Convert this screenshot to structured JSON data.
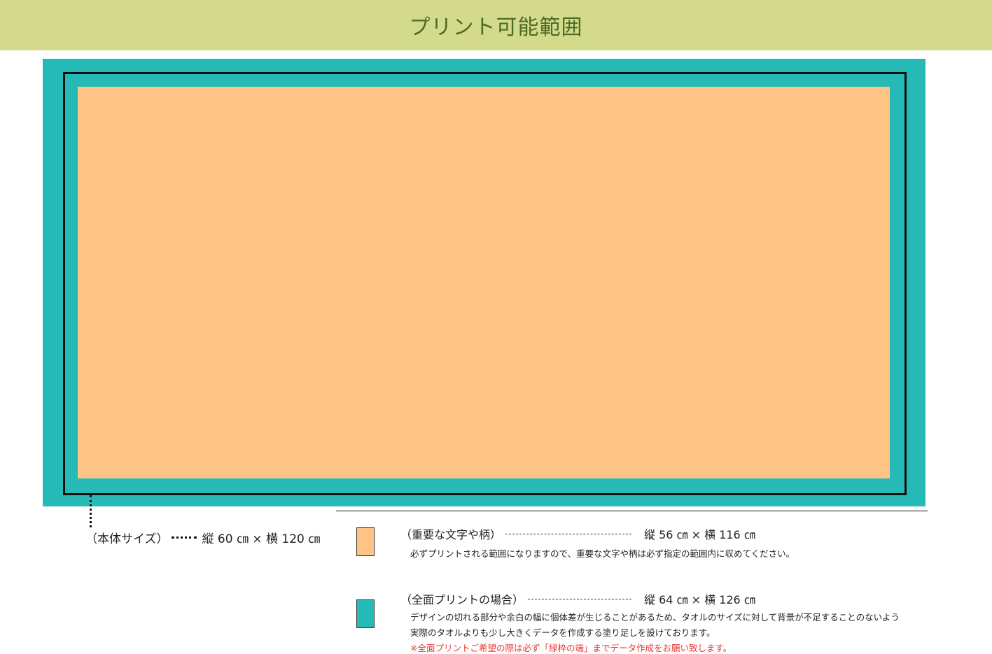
{
  "header": {
    "title": "プリント可能範囲"
  },
  "colors": {
    "header_bg": "#d3da8b",
    "header_text": "#4e6b25",
    "bleed": "#26bab6",
    "safe": "#ffc385",
    "outline": "#111111",
    "note_red": "#e53935"
  },
  "body_size": {
    "label": "（本体サイズ）",
    "dims": "縦 60 ㎝ × 横 120 ㎝"
  },
  "legend": {
    "safe": {
      "label": "（重要な文字や柄）",
      "dims": "縦 56 ㎝ × 横 116 ㎝",
      "desc": "必ずプリントされる範囲になりますので、重要な文字や柄は必ず指定の範囲内に収めてください。"
    },
    "bleed": {
      "label": "（全面プリントの場合）",
      "dims": "縦 64 ㎝ × 横 126 ㎝",
      "desc1": "デザインの切れる部分や余白の幅に個体差が生じることがあるため、タオルのサイズに対して背景が不足することのないよう",
      "desc2": "実際のタオルよりも少し大きくデータを作成する塗り足しを設けております。",
      "note": "※全面プリントご希望の際は必ず「緑枠の端」までデータ作成をお願い致します。"
    }
  }
}
